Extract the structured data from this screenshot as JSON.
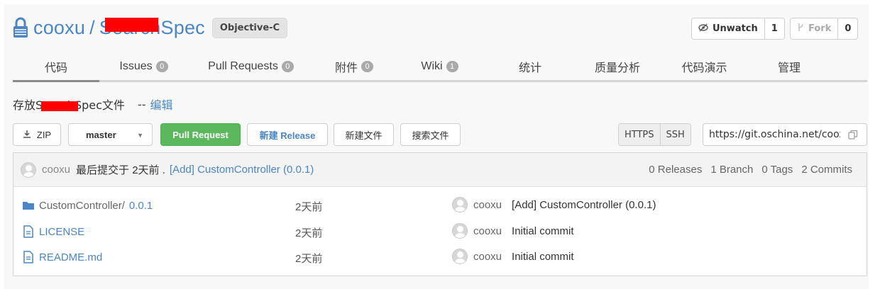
{
  "repo": {
    "owner": "cooxu",
    "separator": "/",
    "name": "SearchSpec",
    "language": "Objective-C"
  },
  "actions": {
    "watch_label": "Unwatch",
    "watch_count": "1",
    "fork_label": "Fork",
    "fork_count": "0"
  },
  "tabs": [
    {
      "label": "代码",
      "count": ""
    },
    {
      "label": "Issues",
      "count": "0"
    },
    {
      "label": "Pull Requests",
      "count": "0"
    },
    {
      "label": "附件",
      "count": "0"
    },
    {
      "label": "Wiki",
      "count": "1"
    },
    {
      "label": "统计",
      "count": ""
    },
    {
      "label": "质量分析",
      "count": ""
    },
    {
      "label": "代码演示",
      "count": ""
    },
    {
      "label": "管理",
      "count": ""
    }
  ],
  "description": {
    "text": "存放SearchSpec文件",
    "edit_sep": "--",
    "edit_label": "编辑"
  },
  "toolbar": {
    "zip": "ZIP",
    "branch": "master",
    "pull_request": "Pull Request",
    "new_release": "新建 Release",
    "new_file": "新建文件",
    "search_file": "搜索文件",
    "https": "HTTPS",
    "ssh": "SSH",
    "clone_url": "https://git.oschina.net/cooxu/SearchSpec.git"
  },
  "latest_commit": {
    "user": "cooxu",
    "message": "最后提交于 2天前 .",
    "link": "[Add] CustomController (0.0.1)"
  },
  "stats": {
    "releases": "0 Releases",
    "branches": "1 Branch",
    "tags": "0 Tags",
    "commits": "2 Commits"
  },
  "files": [
    {
      "type": "folder",
      "name": "CustomController/",
      "sub": "0.0.1",
      "when": "2天前",
      "author": "cooxu",
      "message": "[Add] CustomController (0.0.1)"
    },
    {
      "type": "file",
      "name": "LICENSE",
      "sub": "",
      "when": "2天前",
      "author": "cooxu",
      "message": "Initial commit"
    },
    {
      "type": "file",
      "name": "README.md",
      "sub": "",
      "when": "2天前",
      "author": "cooxu",
      "message": "Initial commit"
    }
  ],
  "colors": {
    "link": "#4a86c6",
    "green": "#5cb85c",
    "redaction": "#ff0000"
  },
  "icons": [
    "lock-icon",
    "eye-slash-icon",
    "fork-icon",
    "download-icon",
    "copy-icon",
    "folder-icon",
    "file-icon",
    "avatar-icon"
  ]
}
